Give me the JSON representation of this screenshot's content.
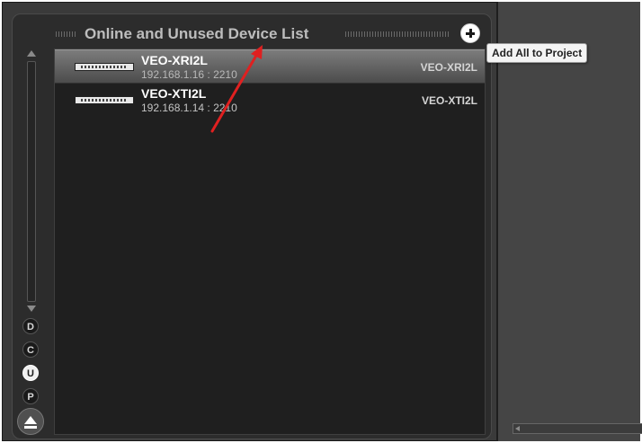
{
  "panel": {
    "title": "Online and Unused Device List",
    "add_all_tooltip": "Add All to Project"
  },
  "filters": [
    {
      "label": "D",
      "active": false
    },
    {
      "label": "C",
      "active": false
    },
    {
      "label": "U",
      "active": true
    },
    {
      "label": "P",
      "active": false
    }
  ],
  "devices": [
    {
      "name": "VEO-XRI2L",
      "address": "192.168.1.16 : 2210",
      "model": "VEO-XRI2L",
      "selected": true
    },
    {
      "name": "VEO-XTI2L",
      "address": "192.168.1.14 : 2210",
      "model": "VEO-XTI2L",
      "selected": false
    }
  ],
  "icons": {
    "add_all": "plus-circle-icon",
    "eject": "eject-icon",
    "annotation": "red-arrow"
  },
  "colors": {
    "background": "#2c2c2c",
    "list_background": "#1f1f1f",
    "selected_row": "#6a6a6a",
    "annotation_arrow": "#e02020"
  }
}
